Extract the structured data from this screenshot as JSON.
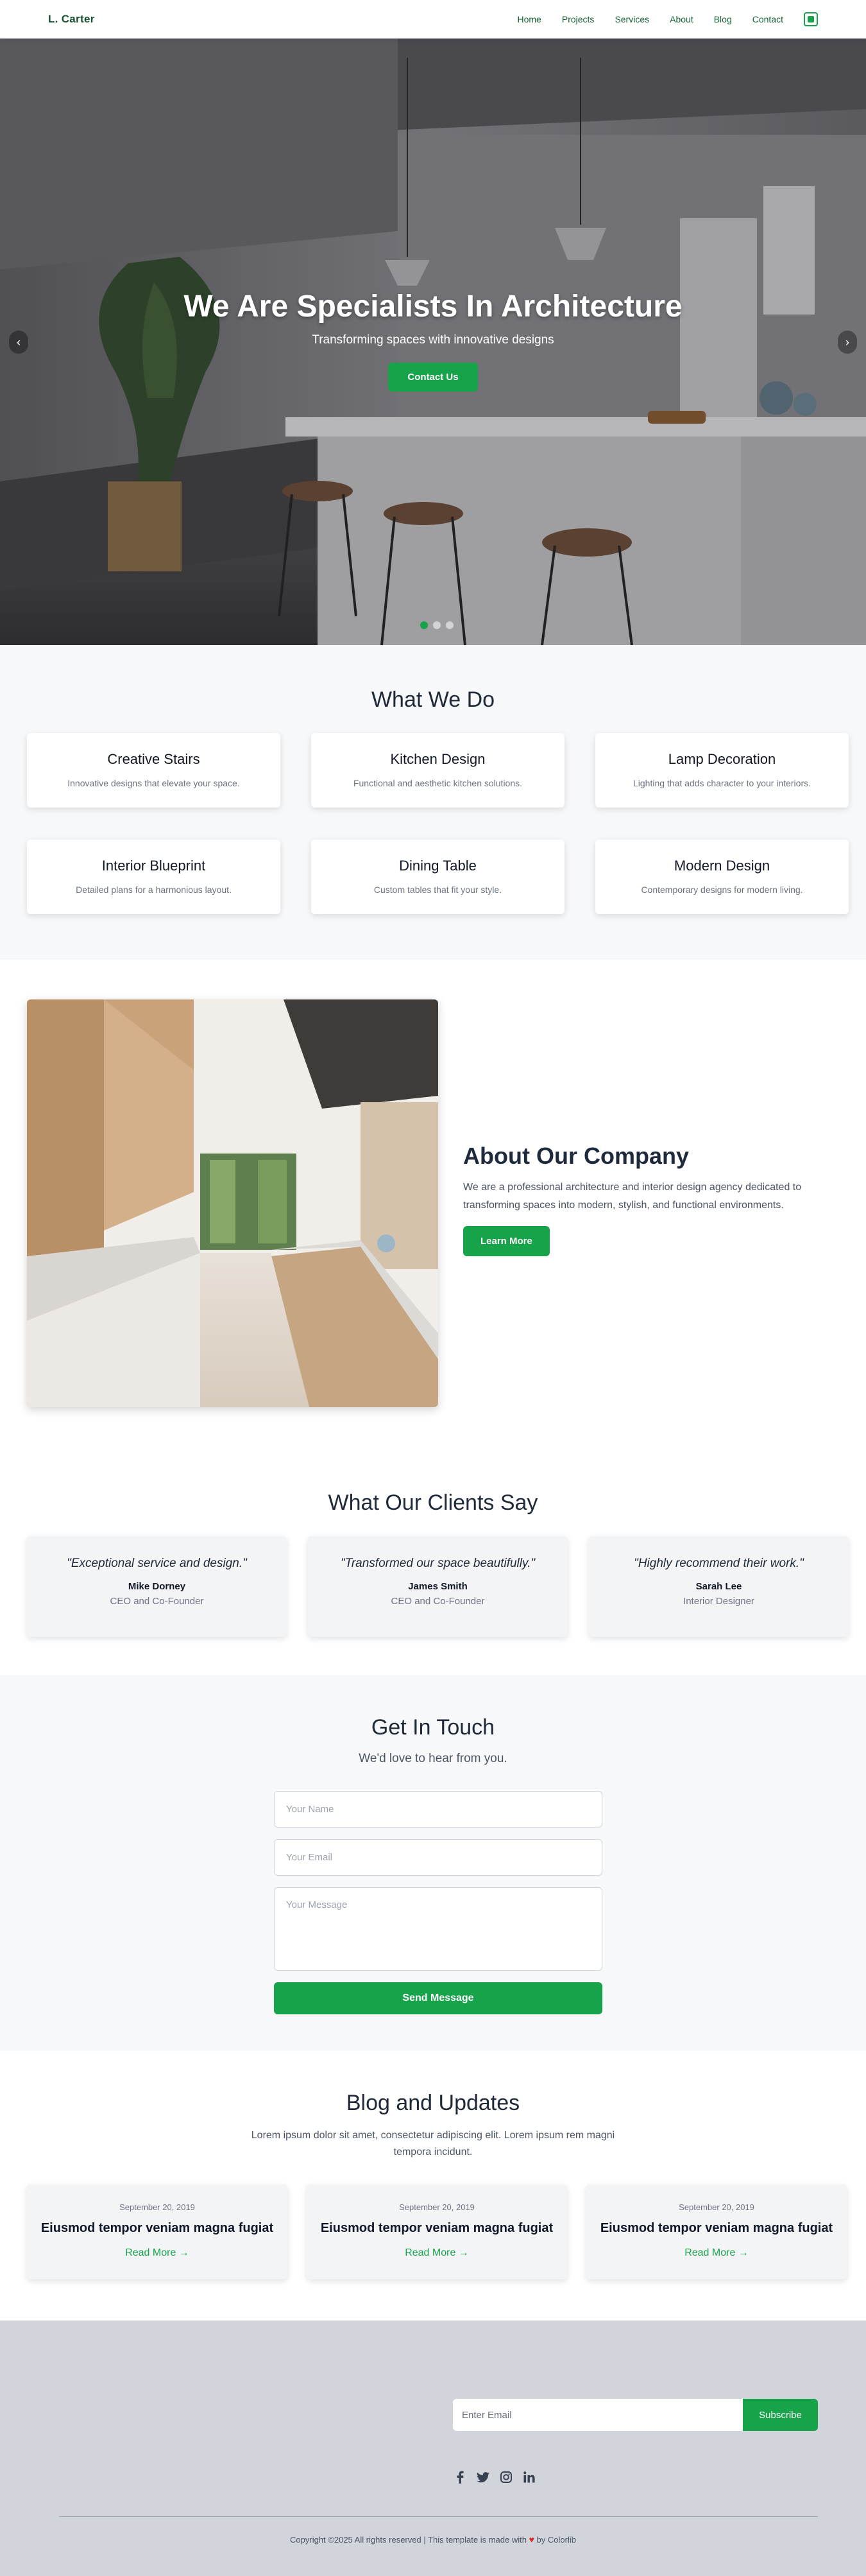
{
  "nav": {
    "brand": "L. Carter",
    "links": [
      "Home",
      "Projects",
      "Services",
      "About",
      "Blog",
      "Contact"
    ],
    "cart_icon": "bag-icon"
  },
  "hero": {
    "title": "We Are Specialists In Architecture",
    "subtitle": "Transforming spaces with innovative designs",
    "button": "Contact Us",
    "prev_icon": "chevron-left-icon",
    "next_icon": "chevron-right-icon",
    "active_slide": 1,
    "slides": 3
  },
  "services": {
    "title": "What We Do",
    "items": [
      {
        "title": "Creative Stairs",
        "desc": "Innovative designs that elevate your space."
      },
      {
        "title": "Kitchen Design",
        "desc": "Functional and aesthetic kitchen solutions."
      },
      {
        "title": "Lamp Decoration",
        "desc": "Lighting that adds character to your interiors."
      },
      {
        "title": "Interior Blueprint",
        "desc": "Detailed plans for a harmonious layout."
      },
      {
        "title": "Dining Table",
        "desc": "Custom tables that fit your style."
      },
      {
        "title": "Modern Design",
        "desc": "Contemporary designs for modern living."
      }
    ]
  },
  "about": {
    "title": "About Our Company",
    "desc": "We are a professional architecture and interior design agency dedicated to transforming spaces into modern, stylish, and functional environments.",
    "button": "Learn More"
  },
  "testimonials": {
    "title": "What Our Clients Say",
    "items": [
      {
        "quote": "\"Exceptional service and design.\"",
        "name": "Mike Dorney",
        "role": "CEO and Co-Founder"
      },
      {
        "quote": "\"Transformed our space beautifully.\"",
        "name": "James Smith",
        "role": "CEO and Co-Founder"
      },
      {
        "quote": "\"Highly recommend their work.\"",
        "name": "Sarah Lee",
        "role": "Interior Designer"
      }
    ]
  },
  "contact": {
    "title": "Get In Touch",
    "subtitle": "We'd love to hear from you.",
    "name_placeholder": "Your Name",
    "email_placeholder": "Your Email",
    "message_placeholder": "Your Message",
    "button": "Send Message"
  },
  "blog": {
    "title": "Blog and Updates",
    "subtitle": "Lorem ipsum dolor sit amet, consectetur adipiscing elit. Lorem ipsum rem magni tempora incidunt.",
    "posts": [
      {
        "date": "September 20, 2019",
        "title": "Eiusmod tempor veniam magna fugiat",
        "link": "Read More →"
      },
      {
        "date": "September 20, 2019",
        "title": "Eiusmod tempor veniam magna fugiat",
        "link": "Read More →"
      },
      {
        "date": "September 20, 2019",
        "title": "Eiusmod tempor veniam magna fugiat",
        "link": "Read More →"
      }
    ]
  },
  "footer": {
    "email_placeholder": "Enter Email",
    "subscribe": "Subscribe",
    "socials": [
      "facebook-icon",
      "twitter-icon",
      "instagram-icon",
      "linkedin-icon"
    ],
    "copyright_pre": "Copyright ©2025 All rights reserved | This template is made with",
    "copyright_post": "by Colorlib"
  },
  "colors": {
    "accent": "#16a34a",
    "brand": "#14532d",
    "footer_bg": "#d1d5db",
    "section_bg": "#f7f8fa"
  }
}
